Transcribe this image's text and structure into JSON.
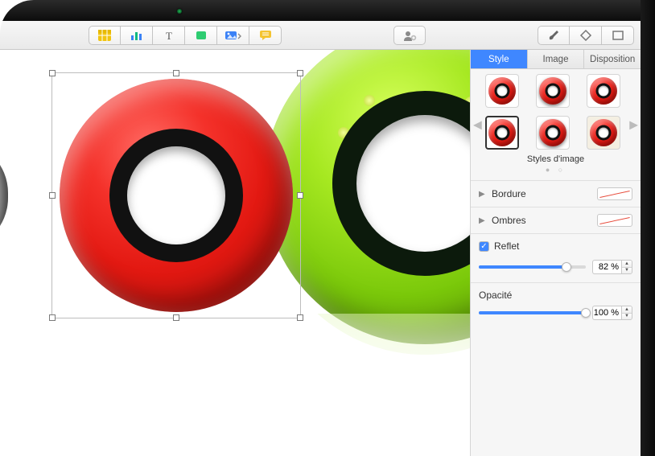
{
  "toolbar": {
    "icons": [
      "table-icon",
      "chart-icon",
      "text-icon",
      "shape-icon",
      "media-icon",
      "comment-icon",
      "collab-icon",
      "format-icon",
      "filter-icon",
      "view-icon"
    ]
  },
  "inspector": {
    "tabs": {
      "style": "Style",
      "image": "Image",
      "layout": "Disposition",
      "active": "style"
    },
    "styleGridCaption": "Styles d'image",
    "sections": {
      "border": {
        "label": "Bordure"
      },
      "shadow": {
        "label": "Ombres"
      },
      "reflection": {
        "label": "Reflet",
        "checked": true,
        "value": "82 %",
        "percent": 82
      },
      "opacity": {
        "label": "Opacité",
        "value": "100 %",
        "percent": 100
      }
    }
  }
}
